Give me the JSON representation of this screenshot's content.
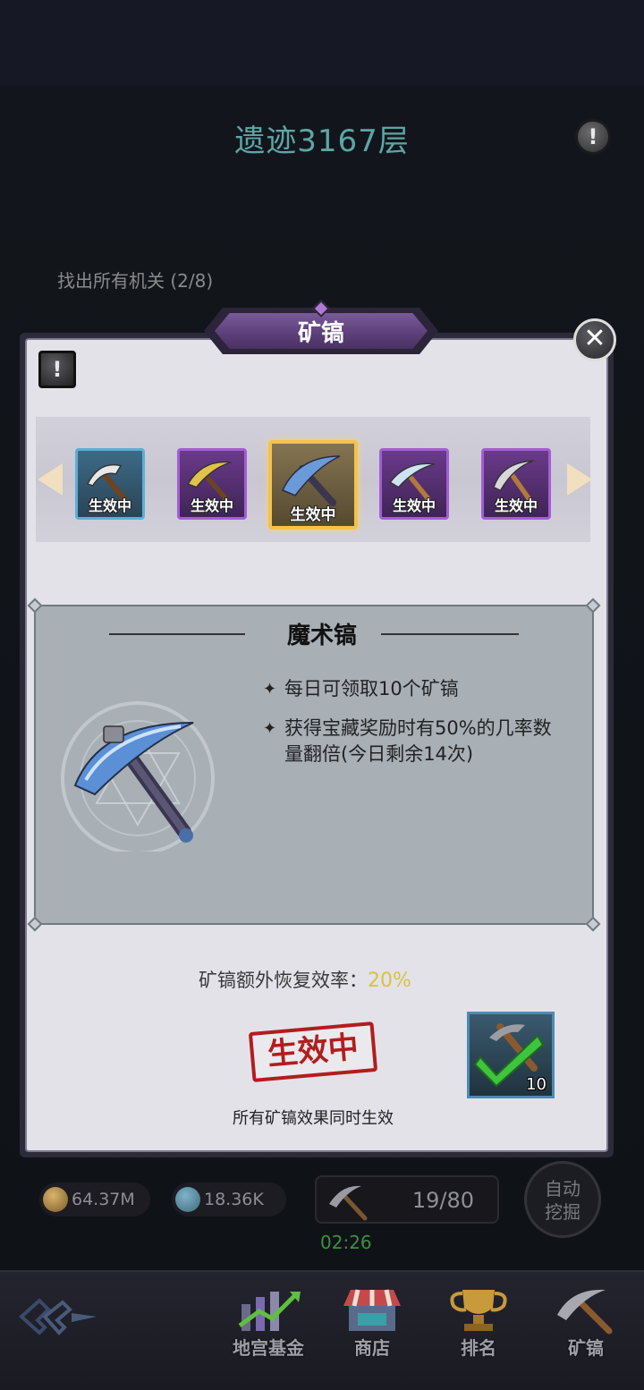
{
  "header": {
    "title": "遗迹3167层",
    "quest": "找出所有机关 (2/8)"
  },
  "dialog": {
    "title": "矿镐",
    "picks": [
      {
        "name": "pick-1",
        "status": "生效中",
        "color": "blue"
      },
      {
        "name": "pick-2",
        "status": "生效中",
        "color": "purple"
      },
      {
        "name": "pick-3",
        "status": "生效中",
        "color": "gold",
        "selected": true
      },
      {
        "name": "pick-4",
        "status": "生效中",
        "color": "purple"
      },
      {
        "name": "pick-5",
        "status": "生效中",
        "color": "purple"
      }
    ],
    "detail": {
      "name": "魔术镐",
      "bullets": [
        "每日可领取10个矿镐",
        "获得宝藏奖励时有50%的几率数量翻倍(今日剩余14次)"
      ]
    },
    "rate_label": "矿镐额外恢复效率：",
    "rate_value": "20%",
    "stamp": "生效中",
    "note": "所有矿镐效果同时生效",
    "confirm_count": "10"
  },
  "resources": {
    "coins": "64.37M",
    "gems": "18.36K",
    "picks": "19/80",
    "timer": "02:26",
    "auto_dig": "自动\n挖掘"
  },
  "nav": {
    "items": [
      "地宫基金",
      "商店",
      "排名",
      "矿镐"
    ]
  },
  "colors": {
    "accent_gold": "#f3c34a",
    "stamp_red": "#b21d1d",
    "rate_value": "#d7c33d",
    "title_teal": "#5da6a6"
  }
}
